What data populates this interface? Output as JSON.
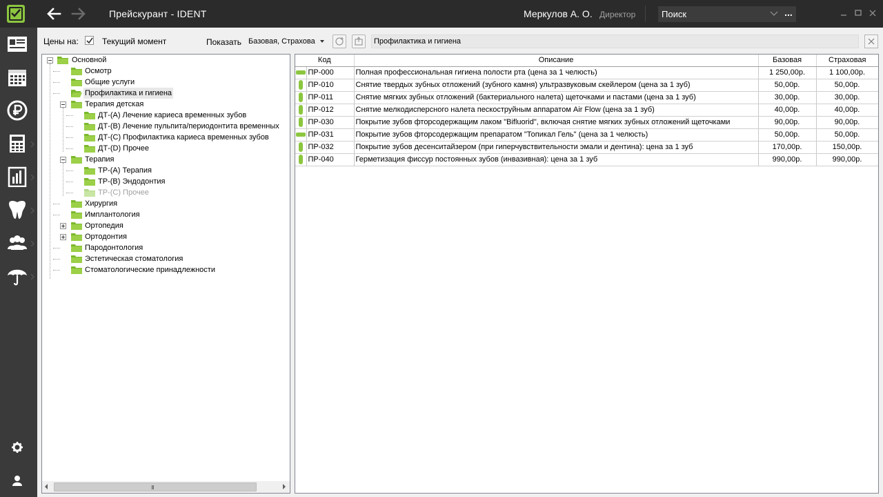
{
  "titlebar": {
    "title": "Прейскурант  -  IDENT",
    "user_name": "Меркулов А. О.",
    "user_role": "Директор",
    "search_placeholder": "Поиск",
    "search_more": "...",
    "accent": "#8cc63f"
  },
  "sidebar": {
    "items": [
      {
        "icon": "patient-card-icon"
      },
      {
        "icon": "calendar-icon"
      },
      {
        "icon": "ruble-coin-icon"
      },
      {
        "icon": "calculator-icon"
      },
      {
        "icon": "report-chart-icon"
      },
      {
        "icon": "tooth-icon"
      },
      {
        "icon": "users-icon"
      },
      {
        "icon": "umbrella-icon"
      }
    ],
    "bottom": [
      {
        "icon": "gear-icon"
      },
      {
        "icon": "user-icon"
      }
    ]
  },
  "toolbar": {
    "prices_label": "Цены на:",
    "current_moment": "Текущий момент",
    "show_label": "Показать",
    "show_value": "Базовая, Страхова",
    "category_value": "Профилактика и гигиена"
  },
  "tree": {
    "items": [
      {
        "label": "Основной"
      },
      {
        "label": "Осмотр"
      },
      {
        "label": "Общие услуги"
      },
      {
        "label": "Профилактика и гигиена"
      },
      {
        "label": "Терапия детская"
      },
      {
        "label": "ДТ-(А) Лечение кариеса временных зубов"
      },
      {
        "label": "ДТ-(В) Лечение пульпита/периодонтита временных"
      },
      {
        "label": "ДТ-(С) Профилактика кариеса временных зубов"
      },
      {
        "label": "ДТ-(D) Прочее"
      },
      {
        "label": "Терапия"
      },
      {
        "label": "ТР-(А) Терапия"
      },
      {
        "label": "ТР-(В) Эндодонтия"
      },
      {
        "label": "ТР-(С) Прочее"
      },
      {
        "label": "Хирургия"
      },
      {
        "label": "Имплантология"
      },
      {
        "label": "Ортопедия"
      },
      {
        "label": "Ортодонтия"
      },
      {
        "label": "Пародонтология"
      },
      {
        "label": "Эстетическая стоматология"
      },
      {
        "label": "Стоматологические принадлежности"
      }
    ],
    "scroll_grip": "III"
  },
  "table": {
    "headers": {
      "code": "Код",
      "description": "Описание",
      "base": "Базовая",
      "insurance": "Страховая"
    },
    "rows": [
      {
        "icon": "jaw-icon",
        "code": "ПР-000",
        "description": "Полная профессиональная гигиена полости рта (цена за 1 челюсть)",
        "base": "1 250,00р.",
        "insurance": "1 100,00р."
      },
      {
        "icon": "tooth-icon",
        "code": "ПР-010",
        "description": "Снятие твердых зубных отложений (зубного камня) ультразвуковым скейлером (цена за 1 зуб)",
        "base": "50,00р.",
        "insurance": "50,00р."
      },
      {
        "icon": "tooth-icon",
        "code": "ПР-011",
        "description": "Снятие мягких зубных отложений (бактериального налета) щеточками и пастами (цена за 1 зуб)",
        "base": "30,00р.",
        "insurance": "30,00р."
      },
      {
        "icon": "tooth-icon",
        "code": "ПР-012",
        "description": "Снятие мелкодисперсного налета пескоструйным аппаратом Air Flow (цена за 1 зуб)",
        "base": "40,00р.",
        "insurance": "40,00р."
      },
      {
        "icon": "tooth-icon",
        "code": "ПР-030",
        "description": "Покрытие зубов фторсодержащим лаком \"Bifluorid\", включая снятие мягких зубных отложений щеточками",
        "base": "90,00р.",
        "insurance": "90,00р."
      },
      {
        "icon": "jaw-icon",
        "code": "ПР-031",
        "description": "Покрытие зубов фторсодержащим препаратом \"Топикал Гель\" (цена за 1 челюсть)",
        "base": "50,00р.",
        "insurance": "50,00р."
      },
      {
        "icon": "tooth-icon",
        "code": "ПР-032",
        "description": "Покрытие зубов десенситайзером (при гиперчувствительности эмали и дентина): цена за 1 зуб",
        "base": "170,00р.",
        "insurance": "150,00р."
      },
      {
        "icon": "tooth-icon",
        "code": "ПР-040",
        "description": "Герметизация фиссур постоянных зубов (инвазивная): цена за 1 зуб",
        "base": "990,00р.",
        "insurance": "990,00р."
      }
    ]
  }
}
